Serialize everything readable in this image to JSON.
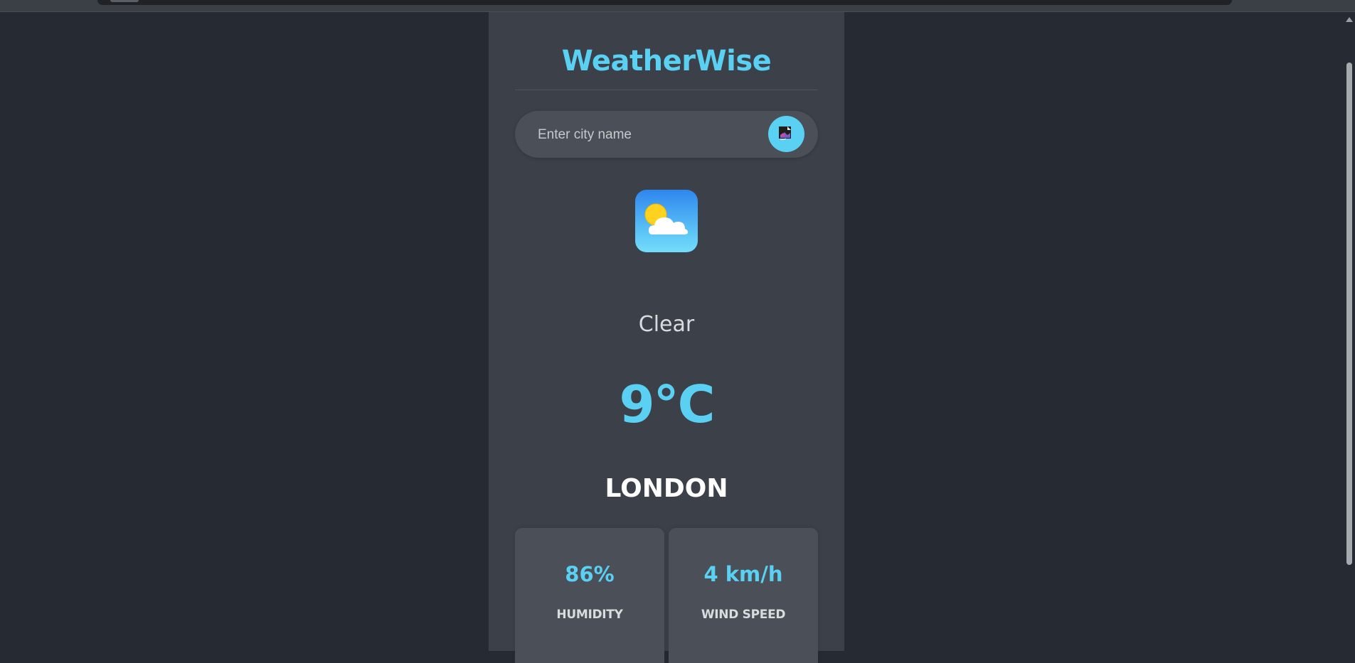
{
  "app": {
    "title": "WeatherWise"
  },
  "search": {
    "placeholder": "Enter city name",
    "value": "",
    "button_icon": "broken-image-icon"
  },
  "weather": {
    "icon": "partly-cloudy-icon",
    "condition": "Clear",
    "temperature": "9°C",
    "city": "LONDON"
  },
  "stats": {
    "humidity": {
      "value": "86%",
      "label": "HUMIDITY"
    },
    "wind": {
      "value": "4 km/h",
      "label": "WIND SPEED"
    }
  },
  "colors": {
    "page_bg": "#262a33",
    "card_bg": "#3b4049",
    "accent": "#5ad0f2",
    "text": "#d9dcdf"
  }
}
